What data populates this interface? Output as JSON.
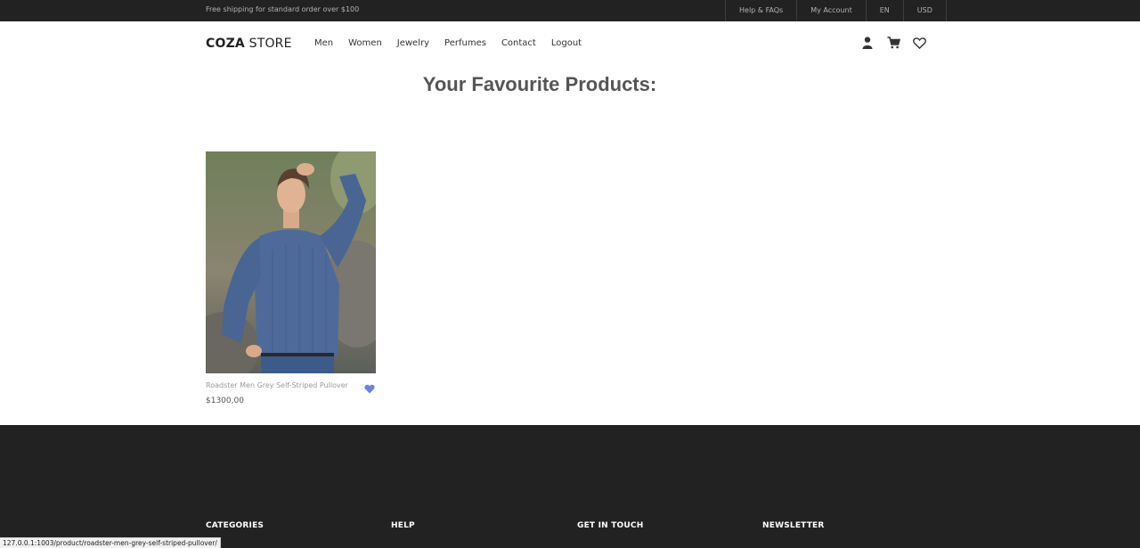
{
  "topbar": {
    "shipping": "Free shipping for standard order over $100",
    "links": [
      "Help & FAQs",
      "My Account",
      "EN",
      "USD"
    ]
  },
  "header": {
    "logo_bold": "COZA",
    "logo_light": " STORE",
    "nav": [
      "Men",
      "Women",
      "Jewelry",
      "Perfumes",
      "Contact",
      "Logout"
    ],
    "icons": [
      "user-icon",
      "cart-icon",
      "heart-icon"
    ]
  },
  "main": {
    "title": "Your Favourite Products:",
    "products": [
      {
        "name": "Roadster Men Grey Self-Striped Pullover",
        "price": "$1300,00",
        "favourited": true
      }
    ]
  },
  "footer": {
    "headings": [
      "CATEGORIES",
      "HELP",
      "GET IN TOUCH",
      "NEWSLETTER"
    ]
  },
  "status_url": "127.0.0.1:1003/product/roadster-men-grey-self-striped-pullover/",
  "colors": {
    "dark": "#222222",
    "accent": "#717fe0"
  }
}
